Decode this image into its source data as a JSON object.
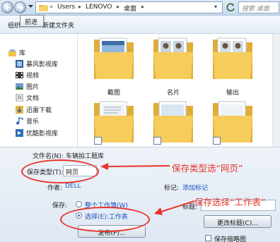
{
  "address": {
    "breadcrumb": [
      "Users",
      "LENOVO",
      "桌面"
    ],
    "search_placeholder": "搜索 桌面"
  },
  "toolbar": {
    "organize": "组织",
    "new_folder": "新建文件夹",
    "tooltip": "前进"
  },
  "sidebar": {
    "items": [
      {
        "label": "库",
        "icon": "library-icon"
      },
      {
        "label": "暴风影视库",
        "icon": "video-library-icon"
      },
      {
        "label": "视频",
        "icon": "video-icon"
      },
      {
        "label": "图片",
        "icon": "picture-icon"
      },
      {
        "label": "文档",
        "icon": "document-icon"
      },
      {
        "label": "迅雷下载",
        "icon": "download-icon"
      },
      {
        "label": "音乐",
        "icon": "music-icon"
      },
      {
        "label": "优酷影视库",
        "icon": "youku-library-icon"
      }
    ]
  },
  "files": [
    {
      "label": "截图"
    },
    {
      "label": "名片"
    },
    {
      "label": "输出"
    },
    {
      "label": ""
    },
    {
      "label": ""
    },
    {
      "label": ""
    }
  ],
  "form": {
    "filename_label": "文件名(N):",
    "filename_value": "车辆拍工题库",
    "savetype_label": "保存类型(T):",
    "savetype_value": "网页",
    "author_label": "作者:",
    "author_value": "DELL",
    "tags_label": "标记:",
    "tags_value": "添加标记",
    "save_label": "保存:",
    "option_whole": "整个工作簿(W)",
    "option_sheet": "选择(E):工作表",
    "title_label": "标题:",
    "publish_button": "发布(P)...",
    "change_title_button": "更改标题(C)...",
    "thumbnail_label": "保存缩略图"
  },
  "annotations": {
    "type_note": "保存类型选“网页”",
    "select_note": "保存选择“工作表”"
  },
  "colors": {
    "annotation": "#e8342c",
    "link": "#1c56c0",
    "folder": "#f5c84a"
  }
}
